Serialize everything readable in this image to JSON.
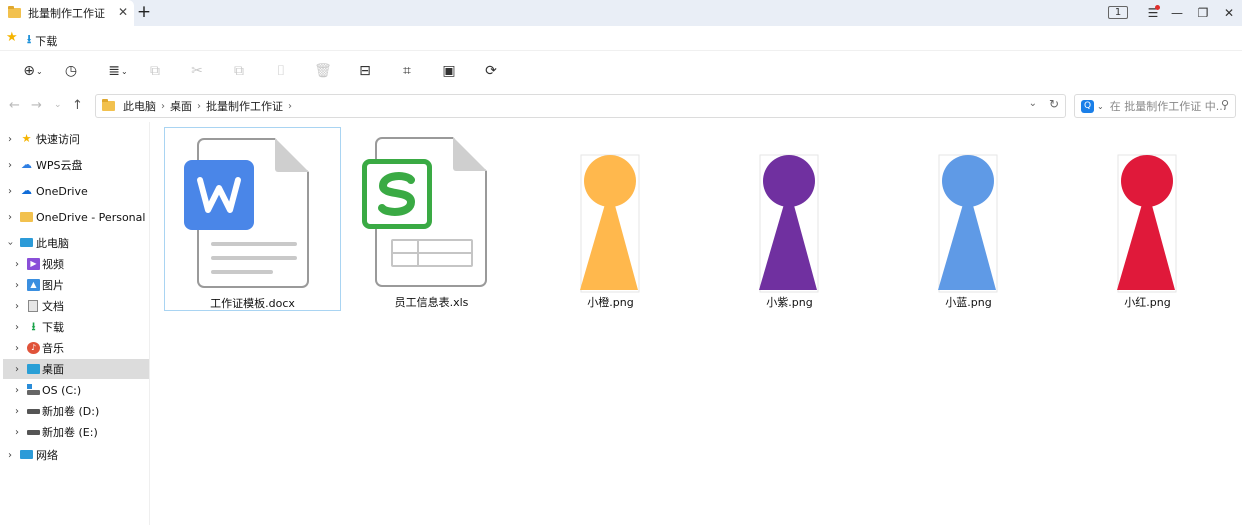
{
  "window": {
    "tab_title": "批量制作工作证",
    "tab_close": "✕",
    "tab_add": "+",
    "tab_count": "1",
    "minimize": "—",
    "maximize": "❐",
    "close": "✕"
  },
  "quickbar": {
    "item": "下载"
  },
  "address": {
    "crumbs": [
      "此电脑",
      "桌面",
      "批量制作工作证"
    ],
    "sep": "›"
  },
  "search": {
    "placeholder": "在 批量制作工作证 中..."
  },
  "sidebar": {
    "items": [
      {
        "label": "快速访问",
        "icon": "star-icon"
      },
      {
        "label": "WPS云盘",
        "icon": "cloud-icon"
      },
      {
        "label": "OneDrive",
        "icon": "onedrive-icon"
      },
      {
        "label": "OneDrive - Personal",
        "icon": "folder-icon"
      },
      {
        "label": "此电脑",
        "icon": "computer-icon"
      },
      {
        "label": "视频",
        "icon": "video-icon"
      },
      {
        "label": "图片",
        "icon": "picture-icon"
      },
      {
        "label": "文档",
        "icon": "document-icon"
      },
      {
        "label": "下载",
        "icon": "download-icon"
      },
      {
        "label": "音乐",
        "icon": "music-icon"
      },
      {
        "label": "桌面",
        "icon": "desktop-icon"
      },
      {
        "label": "OS (C:)",
        "icon": "drive-icon"
      },
      {
        "label": "新加卷 (D:)",
        "icon": "drive-icon"
      },
      {
        "label": "新加卷 (E:)",
        "icon": "drive-icon"
      },
      {
        "label": "网络",
        "icon": "network-icon"
      }
    ]
  },
  "files": [
    {
      "name": "工作证模板.docx",
      "type": "docx",
      "selected": true
    },
    {
      "name": "员工信息表.xls",
      "type": "xls"
    },
    {
      "name": "小橙.png",
      "type": "png",
      "color": "#ffb84d"
    },
    {
      "name": "小紫.png",
      "type": "png",
      "color": "#7030a0"
    },
    {
      "name": "小蓝.png",
      "type": "png",
      "color": "#5f9ae6"
    },
    {
      "name": "小红.png",
      "type": "png",
      "color": "#e0193a"
    }
  ],
  "colors": {
    "wps_blue": "#4a86e8",
    "wps_green": "#3aaa44"
  }
}
